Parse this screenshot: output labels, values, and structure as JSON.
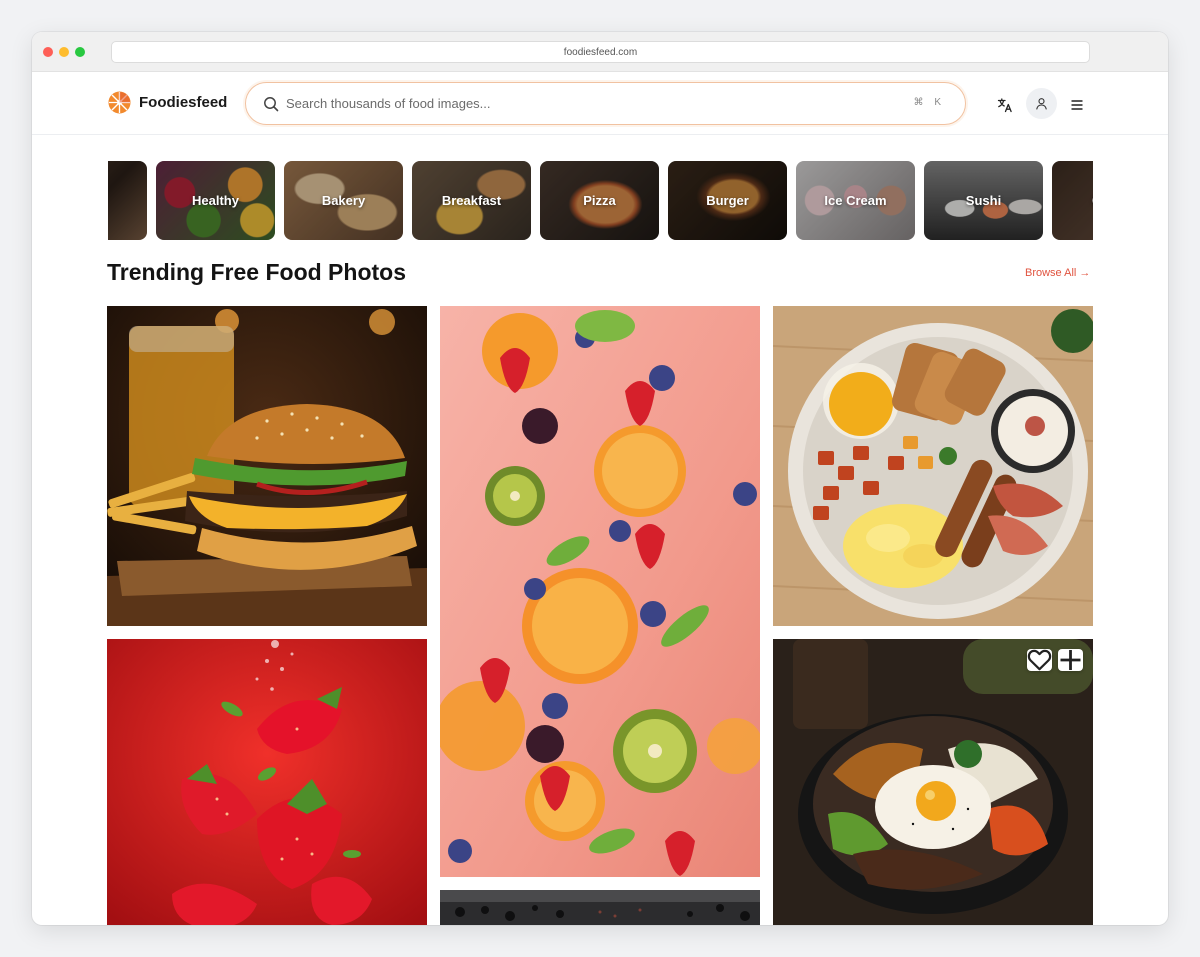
{
  "browser": {
    "url": "foodiesfeed.com"
  },
  "header": {
    "logo_text": "Foodiesfeed",
    "search_placeholder": "Search thousands of food images...",
    "search_shortcut": "⌘ K",
    "icons": [
      "translate-icon",
      "user-icon",
      "menu-icon"
    ]
  },
  "categories": [
    {
      "label": ""
    },
    {
      "label": "Healthy"
    },
    {
      "label": "Bakery"
    },
    {
      "label": "Breakfast"
    },
    {
      "label": "Pizza"
    },
    {
      "label": "Burger"
    },
    {
      "label": "Ice Cream"
    },
    {
      "label": "Sushi"
    },
    {
      "label": "C"
    }
  ],
  "section": {
    "title": "Trending Free Food Photos",
    "browse_all": "Browse All →"
  },
  "colors": {
    "accent": "#e0533f",
    "search_border": "#f1c2a1"
  }
}
